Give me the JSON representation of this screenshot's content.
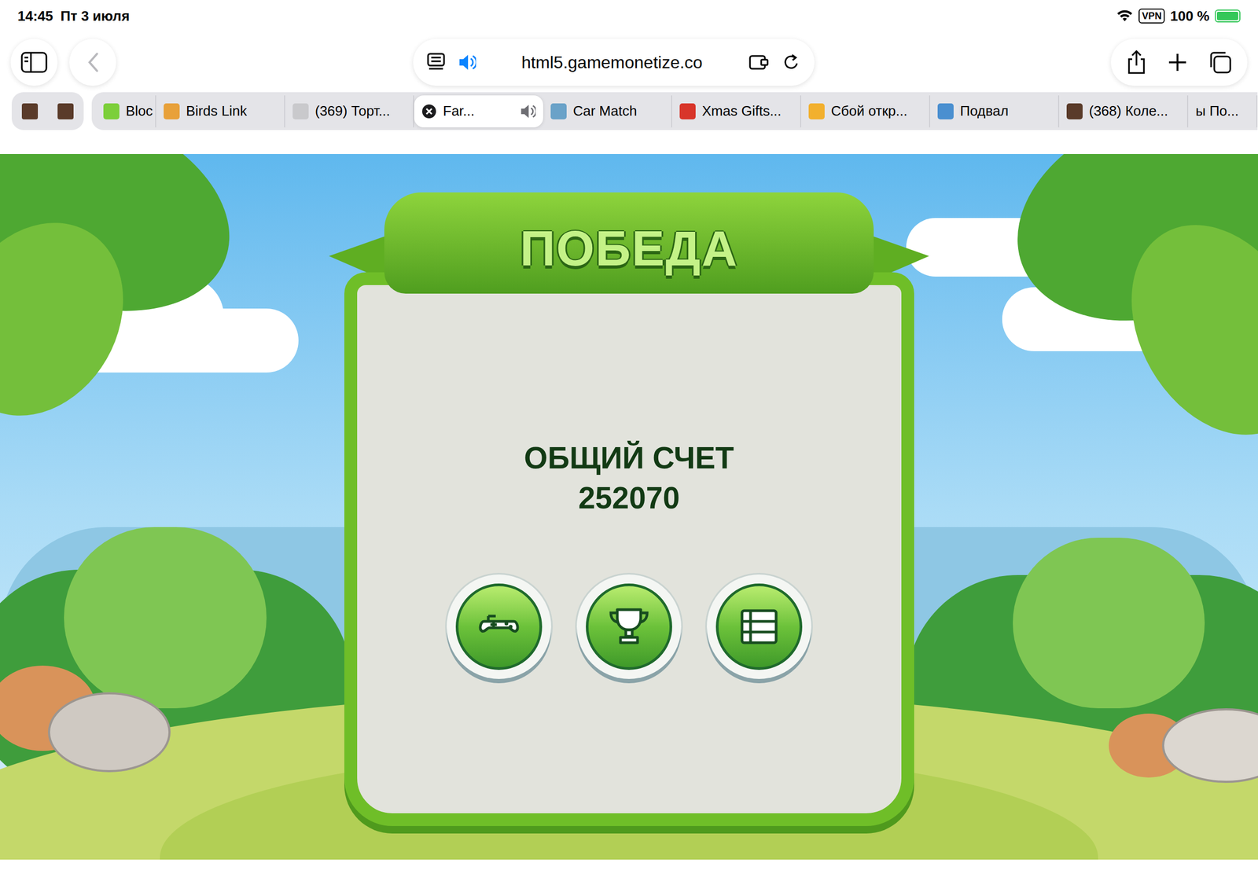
{
  "status_bar": {
    "time": "14:45",
    "date": "Пт 3 июля",
    "vpn": "VPN",
    "battery": "100 %",
    "charging": true
  },
  "toolbar": {
    "url": "html5.gamemonetize.co",
    "audio_playing": true
  },
  "pinned_tabs": [
    {
      "selected": false,
      "color": "#5a3b2a"
    },
    {
      "selected": false,
      "color": "#5a3b2a"
    }
  ],
  "tabs": [
    {
      "label": "Bloc",
      "selected": false,
      "audio": false,
      "color": "#7ccf3a"
    },
    {
      "label": "Birds Link",
      "selected": false,
      "audio": false,
      "color": "#e8a13a"
    },
    {
      "label": "(369) Торт...",
      "selected": false,
      "audio": false,
      "color": "#c9c9cc"
    },
    {
      "label": "Far...",
      "selected": true,
      "audio": true
    },
    {
      "label": "Car Match",
      "selected": false,
      "audio": false,
      "color": "#6aa2c8"
    },
    {
      "label": "Xmas Gifts...",
      "selected": false,
      "audio": false,
      "color": "#d8352a"
    },
    {
      "label": "Сбой откр...",
      "selected": false,
      "audio": false,
      "color": "#f2b02e"
    },
    {
      "label": "Подвал",
      "selected": false,
      "audio": false,
      "color": "#4a8fd0"
    },
    {
      "label": "(368) Коле...",
      "selected": false,
      "audio": false,
      "color": "#5a3b2a"
    },
    {
      "label": "ы По...",
      "selected": false,
      "audio": false
    }
  ],
  "game": {
    "title": "ПОБЕДА",
    "score_label": "ОБЩИЙ СЧЕТ",
    "score": "252070",
    "buttons": [
      {
        "kind": "play"
      },
      {
        "kind": "trophy"
      },
      {
        "kind": "menu"
      }
    ]
  }
}
